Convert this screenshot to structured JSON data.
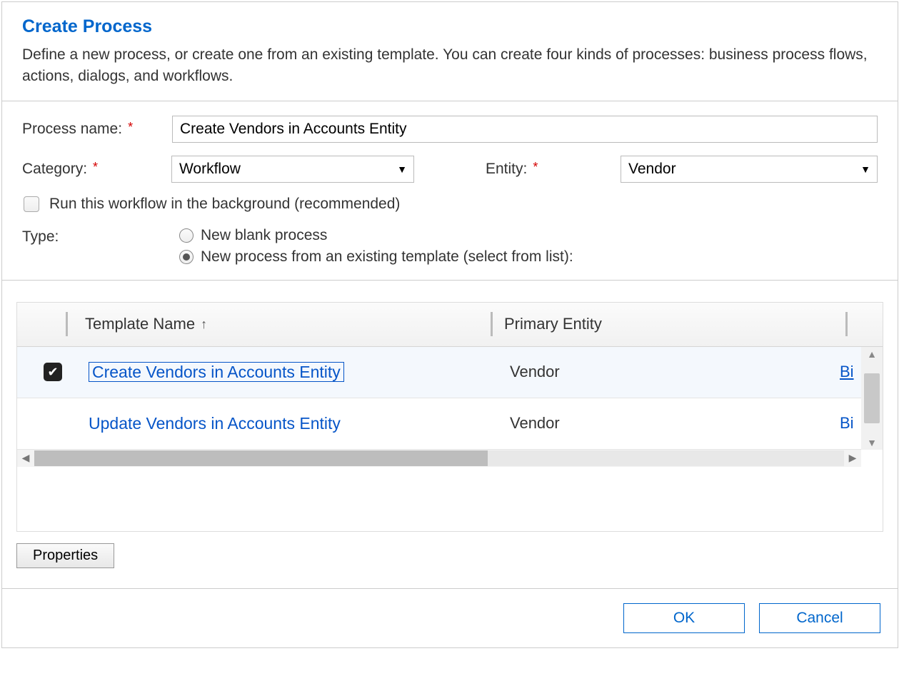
{
  "header": {
    "title": "Create Process",
    "description": "Define a new process, or create one from an existing template. You can create four kinds of processes: business process flows, actions, dialogs, and workflows."
  },
  "form": {
    "process_name_label": "Process name:",
    "process_name_value": "Create Vendors in Accounts Entity",
    "category_label": "Category:",
    "category_value": "Workflow",
    "entity_label": "Entity:",
    "entity_value": "Vendor",
    "background_checkbox_label": "Run this workflow in the background (recommended)",
    "type_label": "Type:",
    "type_option_blank": "New blank process",
    "type_option_template": "New process from an existing template (select from list):"
  },
  "grid": {
    "columns": {
      "template_name": "Template Name",
      "primary_entity": "Primary Entity"
    },
    "rows": [
      {
        "template": "Create Vendors in Accounts Entity",
        "primary": "Vendor",
        "owner": "Bi"
      },
      {
        "template": "Update Vendors in Accounts Entity",
        "primary": "Vendor",
        "owner": "Bi"
      }
    ]
  },
  "buttons": {
    "properties": "Properties",
    "ok": "OK",
    "cancel": "Cancel"
  }
}
